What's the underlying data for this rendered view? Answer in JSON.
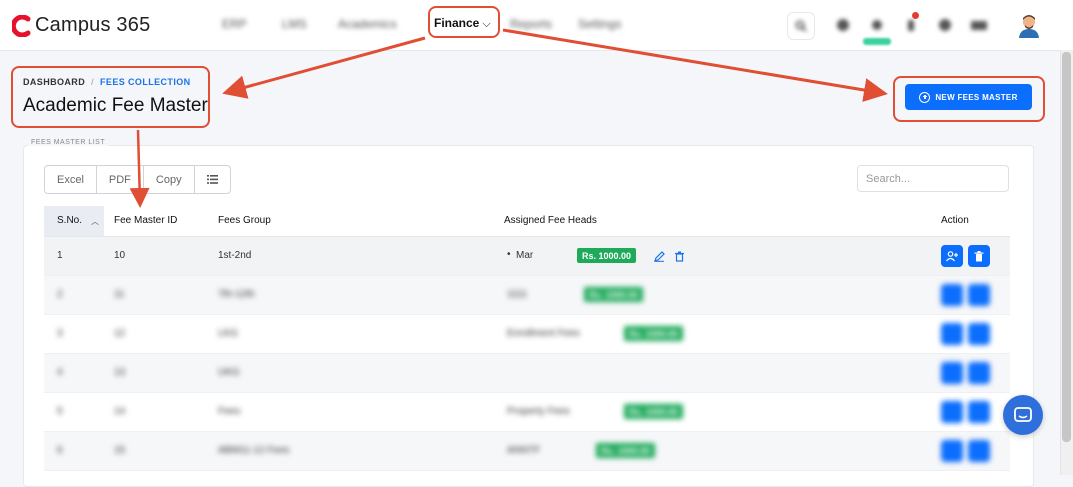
{
  "app": {
    "name": "Campus 365"
  },
  "nav": {
    "items": [
      "ERP",
      "LMS",
      "Academics",
      "Reports",
      "Settings"
    ],
    "active": "Finance"
  },
  "breadcrumb": {
    "home": "DASHBOARD",
    "separator": "/",
    "current": "FEES COLLECTION"
  },
  "page": {
    "title": "Academic Fee Master"
  },
  "actions": {
    "new_button": "NEW FEES MASTER"
  },
  "card": {
    "label": "FEES MASTER LIST"
  },
  "toolbar": {
    "excel": "Excel",
    "pdf": "PDF",
    "copy": "Copy"
  },
  "search": {
    "placeholder": "Search..."
  },
  "table": {
    "headers": {
      "sno": "S.No.",
      "id": "Fee Master ID",
      "group": "Fees Group",
      "heads": "Assigned Fee Heads",
      "action": "Action"
    },
    "rows": [
      {
        "sno": "1",
        "id": "10",
        "group": "1st-2nd",
        "head": "Mar",
        "amount": "Rs. 1000.00"
      },
      {
        "sno": "2",
        "id": "11",
        "group": "7th-12th",
        "head": "1111",
        "amount": "Rs. 1000.00"
      },
      {
        "sno": "3",
        "id": "12",
        "group": "LKG",
        "head": "Enrollment Fees",
        "amount": "Rs. 1000.00"
      },
      {
        "sno": "4",
        "id": "13",
        "group": "UKG",
        "head": "",
        "amount": ""
      },
      {
        "sno": "5",
        "id": "14",
        "group": "Fees",
        "head": "Property Fees",
        "amount": "Rs. 1000.00"
      },
      {
        "sno": "6",
        "id": "15",
        "group": "ABM11-12 Fees",
        "head": "ANNTF",
        "amount": "Rs. 1000.00"
      }
    ]
  },
  "colors": {
    "accent": "#0b6efd",
    "brand": "#e8112d",
    "amount": "#1eaa5a",
    "annotation": "#e04e34"
  }
}
